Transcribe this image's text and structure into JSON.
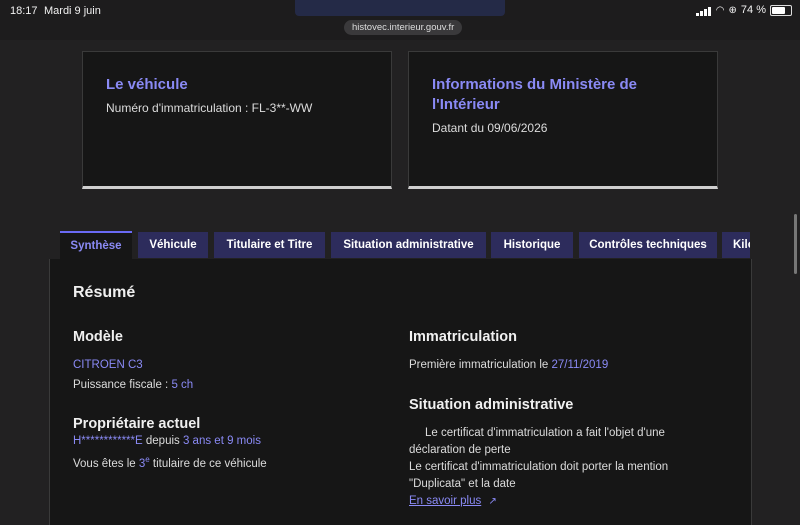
{
  "status": {
    "time": "18:17",
    "date": "Mardi 9 juin",
    "battery": "74 %"
  },
  "url": "histovec.interieur.gouv.fr",
  "cards": {
    "vehicle": {
      "title": "Le véhicule",
      "text": "Numéro d'immatriculation : FL-3**-WW"
    },
    "ministry": {
      "title": "Informations du Ministère de l'Intérieur",
      "text": "Datant du 09/06/2026"
    }
  },
  "tabs": [
    "Synthèse",
    "Véhicule",
    "Titulaire et Titre",
    "Situation administrative",
    "Historique",
    "Contrôles techniques",
    "Kilo"
  ],
  "summary": {
    "title": "Résumé",
    "modele": {
      "heading": "Modèle",
      "name": "CITROEN C3",
      "puissance_label": "Puissance fiscale : ",
      "puissance_value": "5 ch"
    },
    "proprietaire": {
      "heading": "Propriétaire actuel",
      "name": "H************E",
      "depuis_label": " depuis ",
      "depuis_value": "3 ans et 9 mois",
      "rank_prefix": "Vous êtes le ",
      "rank_num": "3",
      "rank_sup": "e",
      "rank_suffix": " titulaire de ce véhicule"
    },
    "immatriculation": {
      "heading": "Immatriculation",
      "label": "Première immatriculation le ",
      "date": "27/11/2019"
    },
    "situation": {
      "heading": "Situation administrative",
      "line1": "Le certificat d'immatriculation a fait l'objet d'une déclaration de perte",
      "line2": "Le certificat d'immatriculation doit porter la mention \"Duplicata\" et la date",
      "link": "En savoir plus"
    }
  }
}
